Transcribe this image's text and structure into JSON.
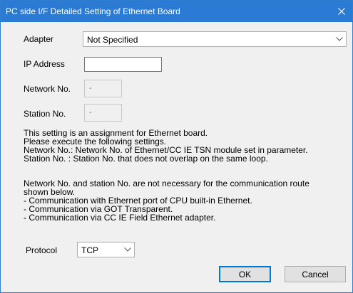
{
  "window": {
    "title": "PC side I/F Detailed Setting of Ethernet Board"
  },
  "fields": {
    "adapter": {
      "label": "Adapter",
      "value": "Not Specified"
    },
    "ip_address": {
      "label": "IP Address",
      "value": ""
    },
    "network_no": {
      "label": "Network No.",
      "value": "-"
    },
    "station_no": {
      "label": "Station No.",
      "value": "-"
    }
  },
  "description": [
    "This setting is an assignment for Ethernet board.",
    "Please execute the following settings.",
    "Network No.: Network No. of Ethernet/CC IE TSN module set in parameter.",
    "Station No.  : Station No. that does not overlap on the same loop.",
    "Network No. and station No. are not necessary for the communication route",
    "shown below.",
    "- Communication with Ethernet port of CPU built-in Ethernet.",
    "- Communication via GOT Transparent.",
    "- Communication via CC IE Field Ethernet adapter."
  ],
  "protocol": {
    "label": "Protocol",
    "value": "TCP"
  },
  "buttons": {
    "ok": "OK",
    "cancel": "Cancel"
  },
  "icons": {
    "close": "close-icon",
    "dropdown": "chevron-down-icon"
  },
  "colors": {
    "titlebar": "#2b7bd4",
    "default_button_border": "#0078d7",
    "dialog_bg": "#f0f0f0"
  }
}
